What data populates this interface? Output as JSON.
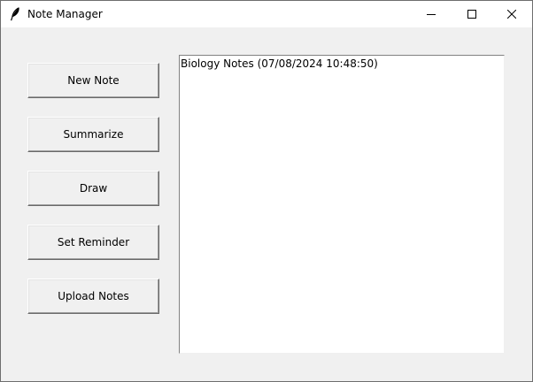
{
  "window": {
    "title": "Note Manager",
    "title_icon": "feather-icon",
    "controls": {
      "minimize_icon": "minimize-icon",
      "maximize_icon": "maximize-icon",
      "close_icon": "close-icon"
    }
  },
  "buttons": {
    "new_note": "New Note",
    "summarize": "Summarize",
    "draw": "Draw",
    "set_reminder": "Set Reminder",
    "upload_notes": "Upload Notes"
  },
  "notes": [
    "Biology Notes (07/08/2024 10:48:50)"
  ],
  "colors": {
    "window_bg": "#f0f0f0",
    "titlebar_bg": "#ffffff",
    "list_bg": "#ffffff"
  }
}
